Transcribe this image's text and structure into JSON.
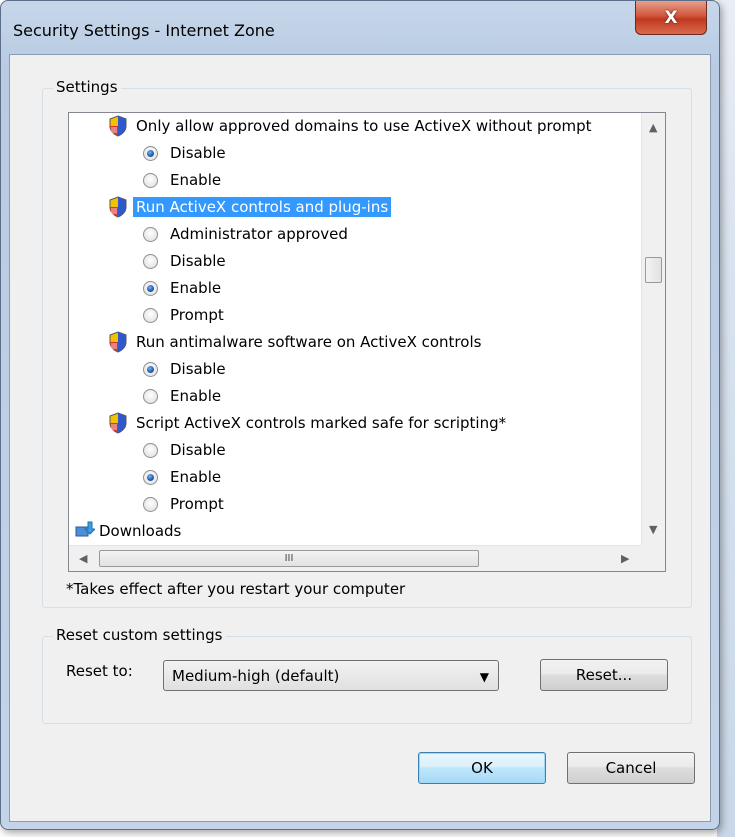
{
  "window": {
    "title": "Security Settings - Internet Zone",
    "close_label": "X"
  },
  "settings_group": {
    "legend": "Settings",
    "items": [
      {
        "type": "category",
        "label": "Only allow approved domains to use ActiveX without prompt",
        "selected": false
      },
      {
        "type": "option",
        "label": "Disable",
        "checked": true
      },
      {
        "type": "option",
        "label": "Enable",
        "checked": false
      },
      {
        "type": "category",
        "label": "Run ActiveX controls and plug-ins",
        "selected": true
      },
      {
        "type": "option",
        "label": "Administrator approved",
        "checked": false
      },
      {
        "type": "option",
        "label": "Disable",
        "checked": false
      },
      {
        "type": "option",
        "label": "Enable",
        "checked": true
      },
      {
        "type": "option",
        "label": "Prompt",
        "checked": false
      },
      {
        "type": "category",
        "label": "Run antimalware software on ActiveX controls",
        "selected": false
      },
      {
        "type": "option",
        "label": "Disable",
        "checked": true
      },
      {
        "type": "option",
        "label": "Enable",
        "checked": false
      },
      {
        "type": "category",
        "label": "Script ActiveX controls marked safe for scripting*",
        "selected": false
      },
      {
        "type": "option",
        "label": "Disable",
        "checked": false
      },
      {
        "type": "option",
        "label": "Enable",
        "checked": true
      },
      {
        "type": "option",
        "label": "Prompt",
        "checked": false
      },
      {
        "type": "section",
        "label": "Downloads"
      }
    ],
    "h_thumb_grip": "III",
    "note": "*Takes effect after you restart your computer"
  },
  "reset_group": {
    "legend": "Reset custom settings",
    "reset_to_label": "Reset to:",
    "selected_level": "Medium-high (default)",
    "reset_button": "Reset..."
  },
  "buttons": {
    "ok": "OK",
    "cancel": "Cancel"
  }
}
